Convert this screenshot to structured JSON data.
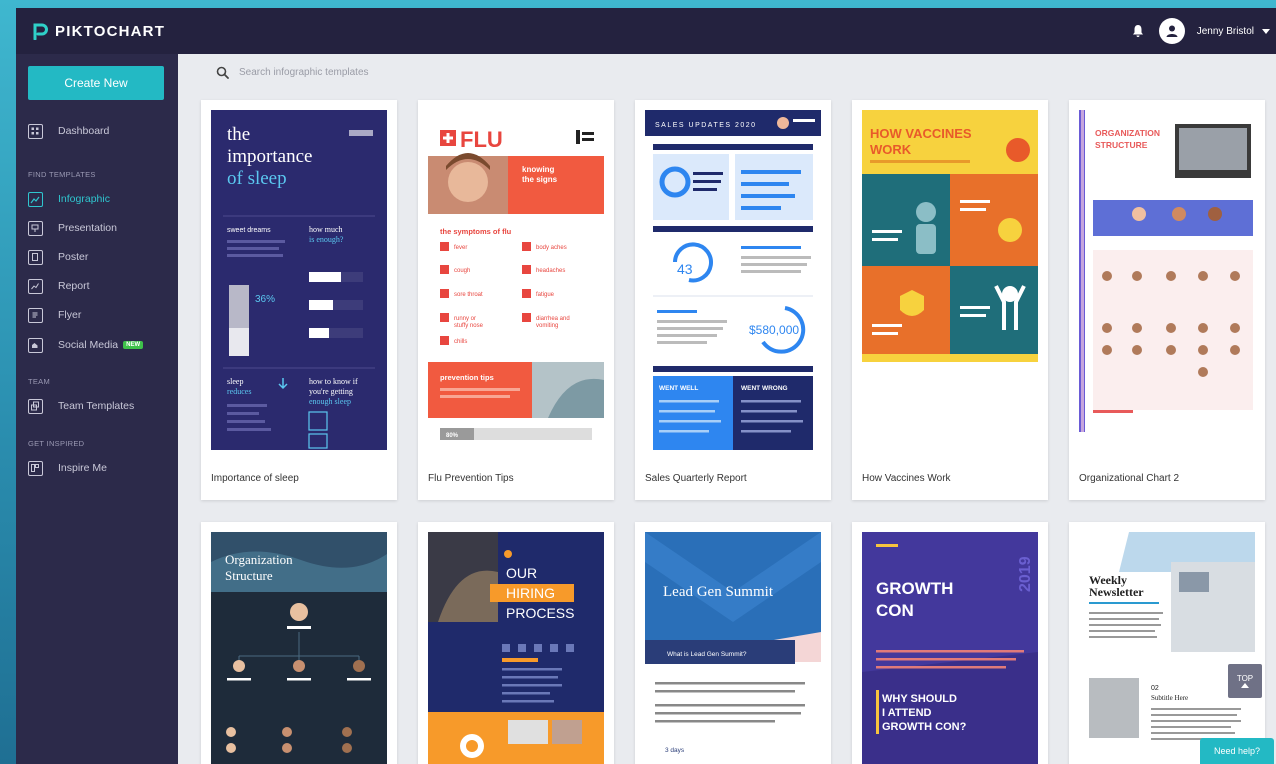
{
  "app": {
    "logo_text": "PIKTOCHART"
  },
  "header": {
    "user_name": "Jenny Bristol"
  },
  "sidebar": {
    "create_label": "Create New",
    "dashboard_label": "Dashboard",
    "find_templates_label": "FIND TEMPLATES",
    "template_items": [
      {
        "label": "Infographic"
      },
      {
        "label": "Presentation"
      },
      {
        "label": "Poster"
      },
      {
        "label": "Report"
      },
      {
        "label": "Flyer"
      },
      {
        "label": "Social Media"
      }
    ],
    "new_badge": "NEW",
    "team_label": "TEAM",
    "team_templates_label": "Team Templates",
    "get_inspired_label": "GET INSPIRED",
    "inspire_me_label": "Inspire Me"
  },
  "search": {
    "placeholder": "Search infographic templates"
  },
  "templates": [
    {
      "title": "Importance of sleep"
    },
    {
      "title": "Flu Prevention Tips"
    },
    {
      "title": "Sales Quarterly Report"
    },
    {
      "title": "How Vaccines Work"
    },
    {
      "title": "Organizational Chart 2"
    }
  ],
  "thumb_text": {
    "sleep_line1": "the",
    "sleep_line2": "importance",
    "sleep_line3": "of sleep",
    "sleep_sweet": "sweet dreams",
    "sleep_how_much": "how much",
    "sleep_enough": "is enough?",
    "sleep_pct": "36%",
    "sleep_reduces": "sleep",
    "sleep_reduces2": "reduces",
    "sleep_know": "how to know if",
    "sleep_know2": "you're getting",
    "sleep_know3": "enough sleep",
    "flu_title": "FLU",
    "flu_signs": "knowing",
    "flu_signs2": "the signs",
    "flu_symptoms": "the symptoms of flu",
    "flu_fever": "fever",
    "flu_cough": "cough",
    "flu_sore": "sore throat",
    "flu_runny": "runny or",
    "flu_runny2": "stuffy nose",
    "flu_chills": "chills",
    "flu_body": "body aches",
    "flu_headaches": "headaches",
    "flu_fatigue": "fatigue",
    "flu_diarrhea": "diarrhea and",
    "flu_diarrhea2": "vomiting",
    "flu_prevention": "prevention tips",
    "flu_pct": "80%",
    "sales_header": "SALES UPDATES 2020",
    "sales_43": "43",
    "sales_580": "$580,000",
    "sales_went_well": "WENT WELL",
    "sales_went_wrong": "WENT WRONG",
    "vacc_line1": "HOW VACCINES",
    "vacc_line2": "WORK",
    "org_line1": "ORGANIZATION",
    "org_line2": "STRUCTURE",
    "r2_org1": "Organization",
    "r2_org2": "Structure",
    "r2_our": "OUR",
    "r2_hiring": "HIRING",
    "r2_process": "PROCESS",
    "r2_lead": "Lead Gen Summit",
    "r2_what_is": "What is Lead Gen Summit?",
    "r2_days": "3 days",
    "r2_growth": "GROWTH",
    "r2_con": "CON",
    "r2_year": "2019",
    "r2_why1": "WHY SHOULD",
    "r2_why2": "I ATTEND",
    "r2_why3": "GROWTH CON?",
    "r2_weekly": "Weekly",
    "r2_newsletter": "Newsletter",
    "r2_subtitle_num": "02",
    "r2_subtitle": "Subtitle Here"
  },
  "floating": {
    "top_label": "TOP",
    "help_label": "Need help?"
  }
}
